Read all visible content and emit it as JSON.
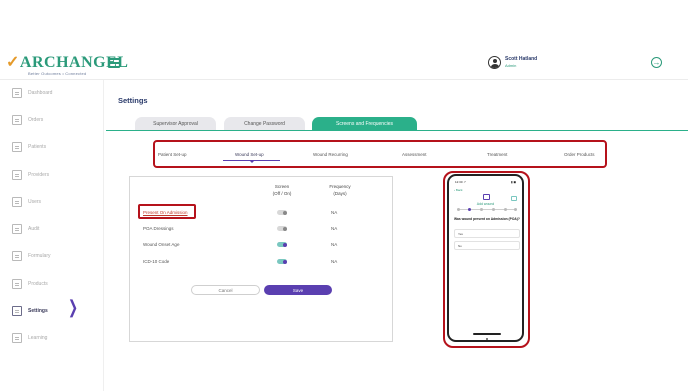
{
  "header": {
    "logo_text": "ARCHANGEL",
    "logo_tagline": "Better Outcomes • Connected",
    "user_name": "Scott Hatland",
    "user_role": "Admin",
    "logout_glyph": "→"
  },
  "sidebar": {
    "items": [
      {
        "label": "Dashboard",
        "icon": "dashboard-icon"
      },
      {
        "label": "Orders",
        "icon": "orders-icon"
      },
      {
        "label": "Patients",
        "icon": "patients-icon"
      },
      {
        "label": "Providers",
        "icon": "providers-icon"
      },
      {
        "label": "Users",
        "icon": "users-icon"
      },
      {
        "label": "Audit",
        "icon": "audit-icon"
      },
      {
        "label": "Formulary",
        "icon": "formulary-icon"
      },
      {
        "label": "Products",
        "icon": "products-icon"
      },
      {
        "label": "Settings",
        "icon": "settings-icon",
        "active": true
      },
      {
        "label": "Learning",
        "icon": "learning-icon"
      }
    ],
    "chevron": "❯"
  },
  "page": {
    "title": "Settings",
    "tabs": [
      {
        "label": "Supervisor Approval"
      },
      {
        "label": "Change Password"
      },
      {
        "label": "Screens and Frequencies",
        "active": true
      }
    ],
    "subnav": [
      {
        "label": "Patient Set-up"
      },
      {
        "label": "Wound Set-up",
        "active": true
      },
      {
        "label": "Wound Recurring"
      },
      {
        "label": "Assessment"
      },
      {
        "label": "Treatment"
      },
      {
        "label": "Order Products"
      }
    ]
  },
  "panel": {
    "col_screen_line1": "Screen",
    "col_screen_line2": "(Off / On)",
    "col_freq_line1": "Frequency",
    "col_freq_line2": "(Days)",
    "rows": [
      {
        "label": "Present On Admission",
        "on": false,
        "freq": "NA",
        "link": true
      },
      {
        "label": "POA Dressings",
        "on": false,
        "freq": "NA"
      },
      {
        "label": "Wound Onset Age",
        "on": true,
        "freq": "NA"
      },
      {
        "label": "ICD-10 Code",
        "on": true,
        "freq": "NA"
      }
    ],
    "cancel_label": "Cancel",
    "save_label": "Save"
  },
  "phone": {
    "time": "12:30 ↗",
    "status_right": "▮ ◼",
    "back": "‹ Back",
    "title": "Add wound",
    "question": "Was wound present on Admission (POA)?",
    "options": [
      "Yes",
      "No"
    ]
  },
  "colors": {
    "brand_green": "#2bb08a",
    "accent_purple": "#5a3fb0",
    "highlight_red": "#b5121b"
  }
}
